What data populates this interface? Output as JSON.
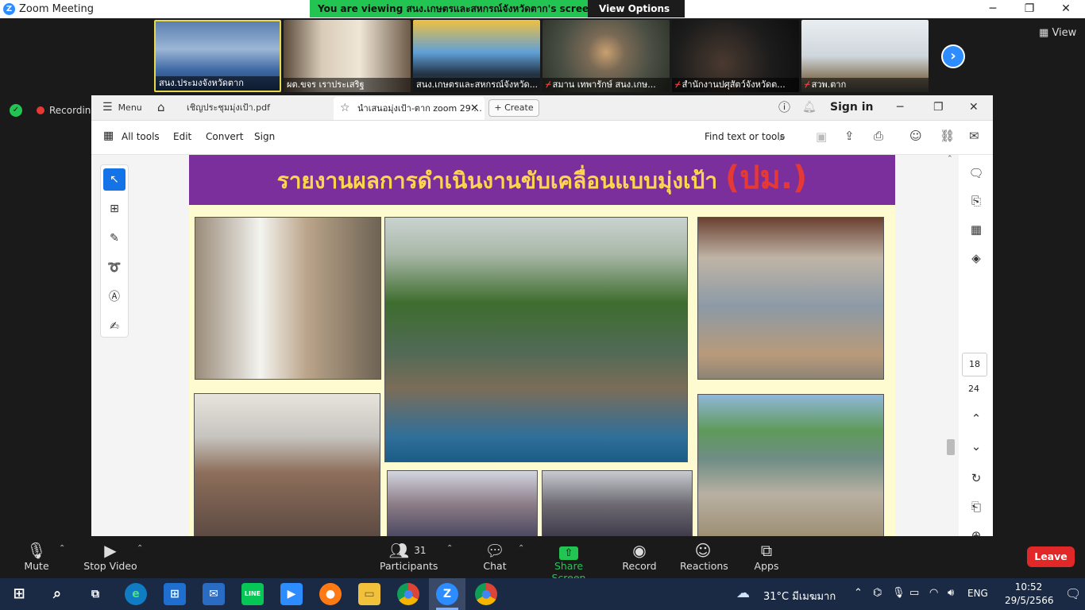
{
  "titlebar": {
    "app_title": "Zoom Meeting",
    "minimize": "─",
    "maximize": "❐",
    "close": "✕"
  },
  "share_banner": {
    "prefix": "You are viewing ",
    "owner": "สนง.เกษตรและสหกรณ์จังหวัดตาก",
    "suffix": "'s screen",
    "view_options": "View Options",
    "caret": "⌄"
  },
  "thumbnails": [
    {
      "name": "สนง.ประมงจังหวัดตาก",
      "muted": false
    },
    {
      "name": "ผต.ขจร เราประเสริฐ",
      "muted": false
    },
    {
      "name": "สนง.เกษตรและสหกรณ์จังหวัด...",
      "muted": false
    },
    {
      "name": "สมาน เทพารักษ์ สนง.เกษ...",
      "muted": true
    },
    {
      "name": "สำนักงานปศุสัตว์จังหวัดต...",
      "muted": true
    },
    {
      "name": "สวพ.ตาก",
      "muted": true
    }
  ],
  "view_button": "View",
  "recording_label": "Recording",
  "acrobat": {
    "menu": "Menu",
    "tab_file": "เชิญประชุมมุ่งเป้า.pdf",
    "tab_active": "นำเสนอมุ่งเป้า-ตาก zoom 29 ...",
    "create": "Create",
    "sign_in": "Sign in",
    "menu_items": [
      "All tools",
      "Edit",
      "Convert",
      "Sign"
    ],
    "find_placeholder": "Find text or tools",
    "page_title_main": "รายงานผลการดำเนินงานขับเคลื่อนแบบมุ่งเป้า ",
    "page_title_tag": "(ปม.)",
    "current_page": "18",
    "total_pages": "24"
  },
  "zoom_controls": {
    "mute": "Mute",
    "stop_video": "Stop Video",
    "participants": "Participants",
    "participants_count": "31",
    "chat": "Chat",
    "share_screen": "Share Screen",
    "record": "Record",
    "reactions": "Reactions",
    "apps": "Apps",
    "leave": "Leave"
  },
  "taskbar": {
    "weather": "31°C มีเมฆมาก",
    "language": "ENG",
    "time": "10:52",
    "date": "29/5/2566"
  },
  "colors": {
    "zoom_blue": "#2d8cff",
    "share_green": "#23c552",
    "slide_purple": "#7b2f9c",
    "slide_yellow": "#ffd54f",
    "leave_red": "#e02828"
  }
}
